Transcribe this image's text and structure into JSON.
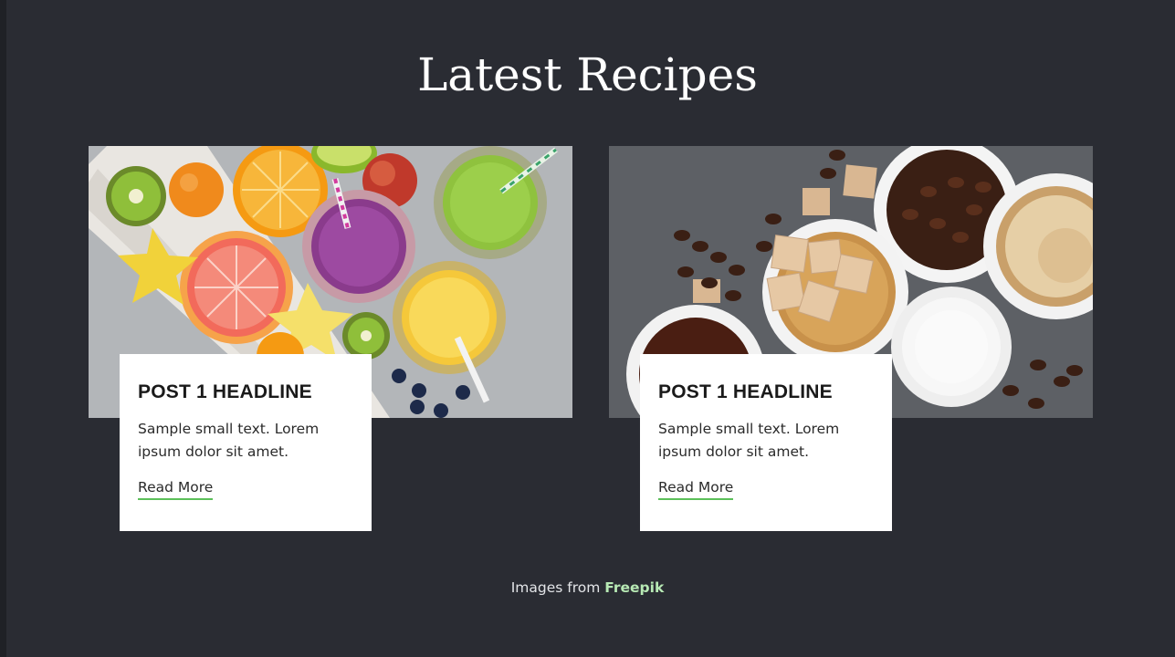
{
  "page": {
    "title": "Latest Recipes",
    "background": "#2a2c33"
  },
  "posts": [
    {
      "image_desc": "fruit-smoothies-photo",
      "headline": "POST 1 HEADLINE",
      "excerpt": "Sample small text. Lorem ipsum dolor sit amet.",
      "link_label": "Read More"
    },
    {
      "image_desc": "coffee-beans-sugar-milk-photo",
      "headline": "POST 1 HEADLINE",
      "excerpt": "Sample small text. Lorem ipsum dolor sit amet.",
      "link_label": "Read More"
    }
  ],
  "footer": {
    "prefix": "Images from",
    "link_label": "Freepik",
    "link_color": "#b7e9b4"
  },
  "colors": {
    "accent_underline": "#5cc05a"
  }
}
